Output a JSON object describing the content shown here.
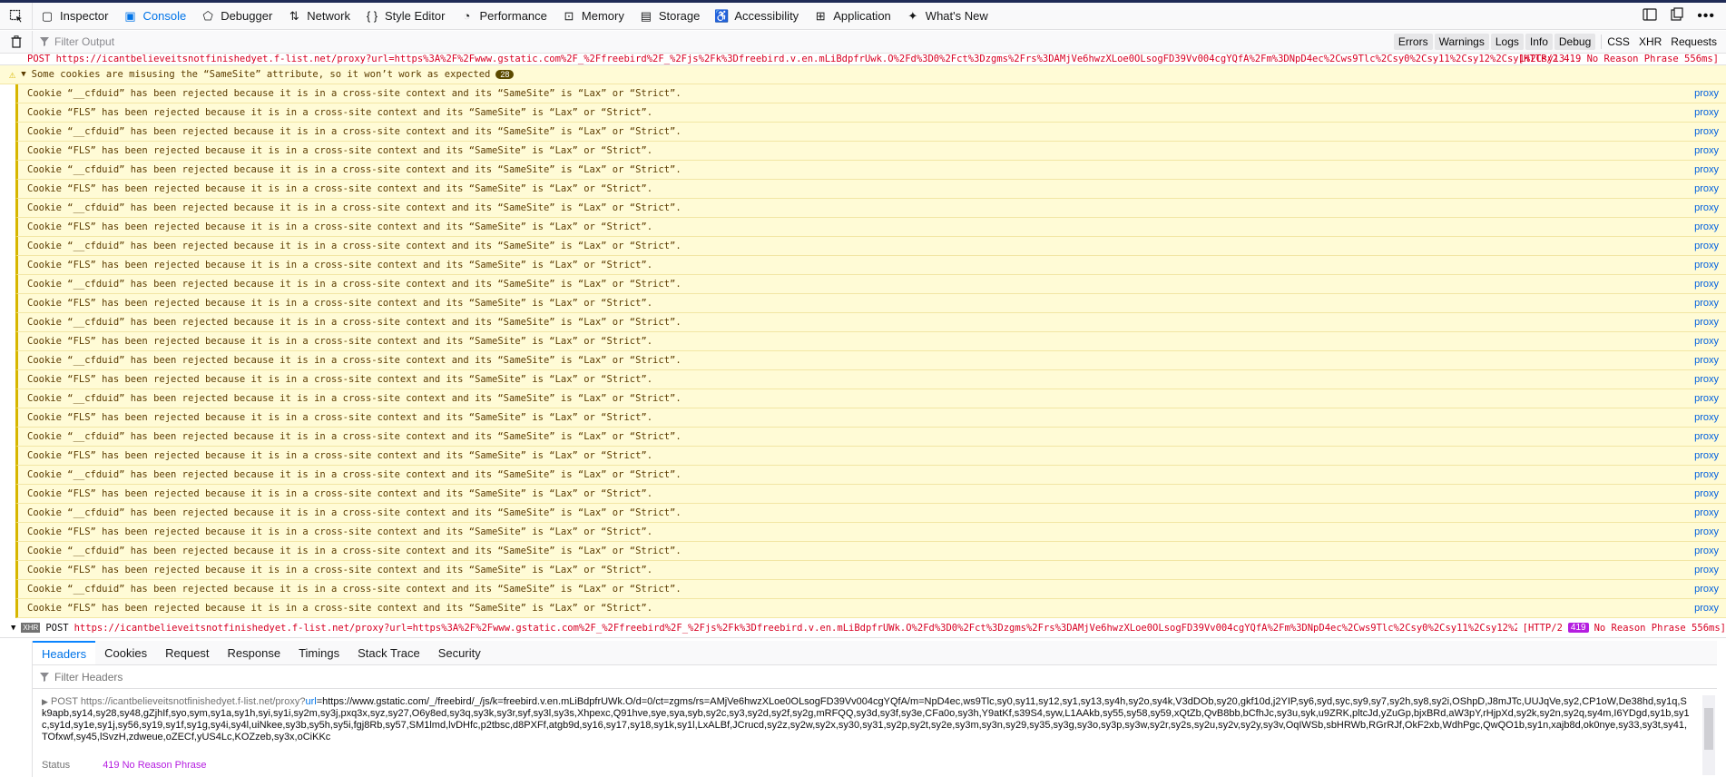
{
  "toolbar": {
    "tabs": [
      {
        "label": "Inspector",
        "icon": "inspector-icon"
      },
      {
        "label": "Console",
        "icon": "console-icon"
      },
      {
        "label": "Debugger",
        "icon": "debugger-icon"
      },
      {
        "label": "Network",
        "icon": "network-icon"
      },
      {
        "label": "Style Editor",
        "icon": "style-editor-icon"
      },
      {
        "label": "Performance",
        "icon": "performance-icon"
      },
      {
        "label": "Memory",
        "icon": "memory-icon"
      },
      {
        "label": "Storage",
        "icon": "storage-icon"
      },
      {
        "label": "Accessibility",
        "icon": "accessibility-icon"
      },
      {
        "label": "Application",
        "icon": "application-icon"
      },
      {
        "label": "What's New",
        "icon": "whats-new-icon"
      }
    ],
    "active_tab": "Console"
  },
  "filter": {
    "placeholder": "Filter Output",
    "levels": [
      "Errors",
      "Warnings",
      "Logs",
      "Info",
      "Debug"
    ],
    "categories": [
      "CSS",
      "XHR",
      "Requests"
    ]
  },
  "console": {
    "top_truncated": "POST https://icantbelieveitsnotfinishedyet.f-list.net/proxy?url=https%3A%2F%2Fwww.gstatic.com%2F_%2Ffreebird%2F_%2Fjs%2Fk%3Dfreebird.v.en.mLiBdpfrUwk.O%2Fd%3D0%2Fct%3Dzgms%2Frs%3DAMjVe6hwzXLoe0OLsogFD39Vv004cgYQfA%2Fm%3DNpD4ec%2Cws9Tlc%2Csy0%2Csy11%2Csy12%2Csy1%2Csy13...",
    "top_truncated_right": "[HTTP/2 419 No Reason Phrase 556ms]",
    "warning_group": {
      "text": "Some cookies are misusing the “SameSite” attribute, so it won’t work as expected",
      "count": "28"
    },
    "messages": [
      "Cookie “__cfduid” has been rejected because it is in a cross-site context and its “SameSite” is “Lax” or “Strict”.",
      "Cookie “FLS” has been rejected because it is in a cross-site context and its “SameSite” is “Lax” or “Strict”.",
      "Cookie “__cfduid” has been rejected because it is in a cross-site context and its “SameSite” is “Lax” or “Strict”.",
      "Cookie “FLS” has been rejected because it is in a cross-site context and its “SameSite” is “Lax” or “Strict”.",
      "Cookie “__cfduid” has been rejected because it is in a cross-site context and its “SameSite” is “Lax” or “Strict”.",
      "Cookie “FLS” has been rejected because it is in a cross-site context and its “SameSite” is “Lax” or “Strict”.",
      "Cookie “__cfduid” has been rejected because it is in a cross-site context and its “SameSite” is “Lax” or “Strict”.",
      "Cookie “FLS” has been rejected because it is in a cross-site context and its “SameSite” is “Lax” or “Strict”.",
      "Cookie “__cfduid” has been rejected because it is in a cross-site context and its “SameSite” is “Lax” or “Strict”.",
      "Cookie “FLS” has been rejected because it is in a cross-site context and its “SameSite” is “Lax” or “Strict”.",
      "Cookie “__cfduid” has been rejected because it is in a cross-site context and its “SameSite” is “Lax” or “Strict”.",
      "Cookie “FLS” has been rejected because it is in a cross-site context and its “SameSite” is “Lax” or “Strict”.",
      "Cookie “__cfduid” has been rejected because it is in a cross-site context and its “SameSite” is “Lax” or “Strict”.",
      "Cookie “FLS” has been rejected because it is in a cross-site context and its “SameSite” is “Lax” or “Strict”.",
      "Cookie “__cfduid” has been rejected because it is in a cross-site context and its “SameSite” is “Lax” or “Strict”.",
      "Cookie “FLS” has been rejected because it is in a cross-site context and its “SameSite” is “Lax” or “Strict”.",
      "Cookie “__cfduid” has been rejected because it is in a cross-site context and its “SameSite” is “Lax” or “Strict”.",
      "Cookie “FLS” has been rejected because it is in a cross-site context and its “SameSite” is “Lax” or “Strict”.",
      "Cookie “__cfduid” has been rejected because it is in a cross-site context and its “SameSite” is “Lax” or “Strict”.",
      "Cookie “FLS” has been rejected because it is in a cross-site context and its “SameSite” is “Lax” or “Strict”.",
      "Cookie “__cfduid” has been rejected because it is in a cross-site context and its “SameSite” is “Lax” or “Strict”.",
      "Cookie “FLS” has been rejected because it is in a cross-site context and its “SameSite” is “Lax” or “Strict”.",
      "Cookie “__cfduid” has been rejected because it is in a cross-site context and its “SameSite” is “Lax” or “Strict”.",
      "Cookie “FLS” has been rejected because it is in a cross-site context and its “SameSite” is “Lax” or “Strict”.",
      "Cookie “__cfduid” has been rejected because it is in a cross-site context and its “SameSite” is “Lax” or “Strict”.",
      "Cookie “FLS” has been rejected because it is in a cross-site context and its “SameSite” is “Lax” or “Strict”.",
      "Cookie “__cfduid” has been rejected because it is in a cross-site context and its “SameSite” is “Lax” or “Strict”.",
      "Cookie “FLS” has been rejected because it is in a cross-site context and its “SameSite” is “Lax” or “Strict”."
    ],
    "source_label": "proxy",
    "xhr": {
      "tag": "XHR",
      "method": "POST",
      "url": "https://icantbelieveitsnotfinishedyet.f-list.net/proxy?url=https%3A%2F%2Fwww.gstatic.com%2F_%2Ffreebird%2F_%2Fjs%2Fk%3Dfreebird.v.en.mLiBdpfrUWk.O%2Fd%3D0%2Fct%3Dzgms%2Frs%3DAMjVe6hwzXLoe0OLsogFD39Vv004cgYQfA%2Fm%3DNpD4ec%2Cws9Tlc%2Csy0%2Csy11%2Csy12%2Csy1%2Csy13...",
      "protocol": "[HTTP/2",
      "status_code": "419",
      "status_text": "No Reason Phrase 556ms]"
    }
  },
  "details": {
    "tabs": [
      "Headers",
      "Cookies",
      "Request",
      "Response",
      "Timings",
      "Stack Trace",
      "Security"
    ],
    "filter_placeholder": "Filter Headers",
    "request": {
      "method": "POST",
      "host": "https://icantbelieveitsnotfinishedyet.f-list.net/proxy?",
      "param_key": "url",
      "param_value": "=https://www.gstatic.com/_/freebird/_/js/k=freebird.v.en.mLiBdpfrUWk.O/d=0/ct=zgms/rs=AMjVe6hwzXLoe0OLsogFD39Vv004cgYQfA/m=NpD4ec,ws9Tlc,sy0,sy11,sy12,sy1,sy13,sy4h,sy2o,sy4k,V3dDOb,sy20,gkf10d,j2YIP,sy6,syd,syc,sy9,sy7,sy2h,sy8,sy2i,OShpD,J8mJTc,UUJqVe,sy2,CP1oW,De38hd,sy1q,Sk9apb,sy14,sy28,sy48,gZjhIf,syo,sym,sy1a,sy1h,syi,sy1i,sy2m,sy3j,pxq3x,syz,sy27,O6y8ed,sy3q,sy3k,sy3r,syf,sy3l,sy3s,Xhpexc,Q91hve,sye,sya,syb,sy2c,sy3,sy2d,sy2f,sy2g,mRFQQ,sy3d,sy3f,sy3e,CFa0o,sy3h,Y9atKf,s39S4,syw,L1AAkb,sy55,sy58,sy59,xQtZb,QvB8bb,bCfhJc,sy3u,syk,u9ZRK,pltcJd,yZuGp,bjxBRd,aW3pY,rHjpXd,sy2k,sy2n,sy2q,sy4m,I6YDgd,sy1b,sy1c,sy1d,sy1e,sy1j,sy56,sy19,sy1f,sy1g,sy4i,sy4l,uiNkee,sy3b,sy5h,sy5i,fgj8Rb,sy57,SM1lmd,lvDHfc,p2tbsc,d8PXFf,atgb9d,sy16,sy17,sy18,sy1k,sy1l,LxALBf,JCrucd,sy2z,sy2w,sy2x,sy30,sy31,sy2p,sy2t,sy2e,sy3m,sy3n,sy29,sy35,sy3g,sy3o,sy3p,sy3w,sy2r,sy2s,sy2u,sy2v,sy2y,sy3v,OqIWSb,sbHRWb,RGrRJf,OkF2xb,WdhPgc,QwQO1b,sy1n,xajb8d,ok0nye,sy33,sy3t,sy41,TOfxwf,sy45,lSvzH,zdweue,oZECf,yUS4Lc,KOZzeb,sy3x,oCiKKc"
    },
    "status_label": "Status",
    "status_value": "419 No Reason Phrase"
  }
}
